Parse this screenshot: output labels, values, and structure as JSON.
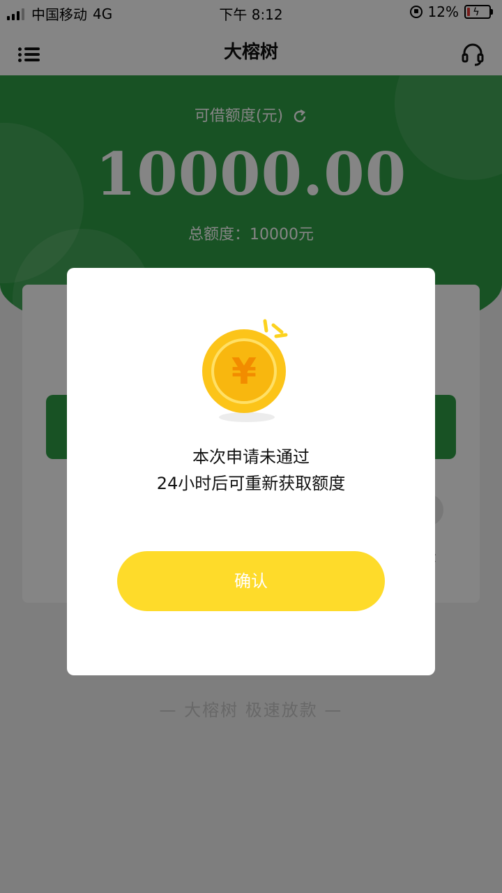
{
  "status_bar": {
    "carrier": "中国移动",
    "network": "4G",
    "time": "下午 8:12",
    "battery_percent": "12%",
    "battery_level": 0.12
  },
  "nav": {
    "title": "大榕树",
    "menu_icon": "menu-list-icon",
    "service_icon": "headset-icon"
  },
  "hero": {
    "label": "可借额度(元)",
    "amount": "10000.00",
    "total_label": "总额度：",
    "total_value": "10000元",
    "refresh_icon": "refresh-icon"
  },
  "card": {
    "link_partial": "录"
  },
  "footer": {
    "slogan": "— 大榕树  极速放款 —"
  },
  "dialog": {
    "icon": "yuan-coin-icon",
    "line1": "本次申请未通过",
    "line2": "24小时后可重新获取额度",
    "confirm_label": "确认"
  },
  "colors": {
    "brand_green": "#2f9d46",
    "confirm_yellow": "#fedb2a",
    "coin_gold": "#fcc419"
  }
}
